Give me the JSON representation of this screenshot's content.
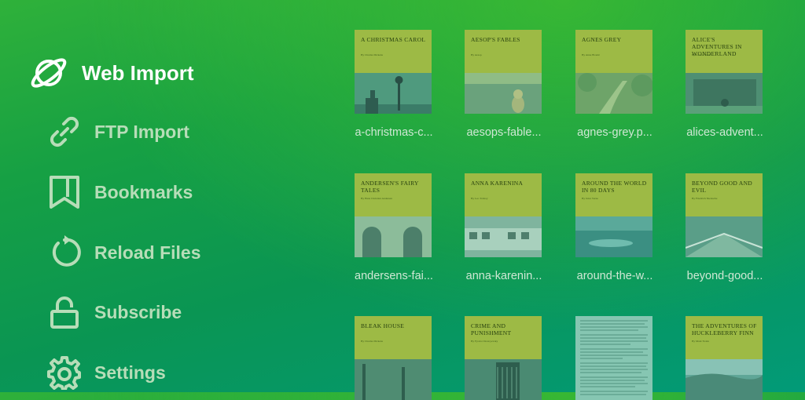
{
  "sidebar": {
    "items": [
      {
        "label": "Web Import",
        "icon": "planet-icon",
        "active": true
      },
      {
        "label": "FTP Import",
        "icon": "link-icon"
      },
      {
        "label": "Bookmarks",
        "icon": "bookmark-icon"
      },
      {
        "label": "Reload Files",
        "icon": "reload-icon"
      },
      {
        "label": "Subscribe",
        "icon": "unlock-icon"
      },
      {
        "label": "Settings",
        "icon": "gear-icon"
      }
    ]
  },
  "books": [
    {
      "title": "A Christmas Carol",
      "author": "By Charles Dickens",
      "file": "a-christmas-c..."
    },
    {
      "title": "Aesop's Fables",
      "author": "By Aesop",
      "file": "aesops-fable..."
    },
    {
      "title": "Agnes Grey",
      "author": "By Anne Brontë",
      "file": "agnes-grey.p..."
    },
    {
      "title": "Alice's Adventures in Wonderland",
      "author": "By Lewis Carroll",
      "file": "alices-advent..."
    },
    {
      "title": "Andersen's Fairy Tales",
      "author": "By Hans Christian Andersen",
      "file": "andersens-fai..."
    },
    {
      "title": "Anna Karenina",
      "author": "By Leo Tolstoy",
      "file": "anna-karenin..."
    },
    {
      "title": "Around the World in 80 Days",
      "author": "By Jules Verne",
      "file": "around-the-w..."
    },
    {
      "title": "Beyond Good and Evil",
      "author": "By Friedrich Nietzsche",
      "file": "beyond-good..."
    },
    {
      "title": "Bleak House",
      "author": "By Charles Dickens",
      "file": ""
    },
    {
      "title": "Crime and Punishment",
      "author": "By Fyodor Dostoyevsky",
      "file": ""
    },
    {
      "title": "",
      "author": "",
      "file": ""
    },
    {
      "title": "The Adventures of Huckleberry Finn",
      "author": "By Mark Twain",
      "file": ""
    }
  ],
  "colors": {
    "accent": "#ffffff",
    "inactive": "#b7ddb8",
    "cover": "#9dba45"
  }
}
